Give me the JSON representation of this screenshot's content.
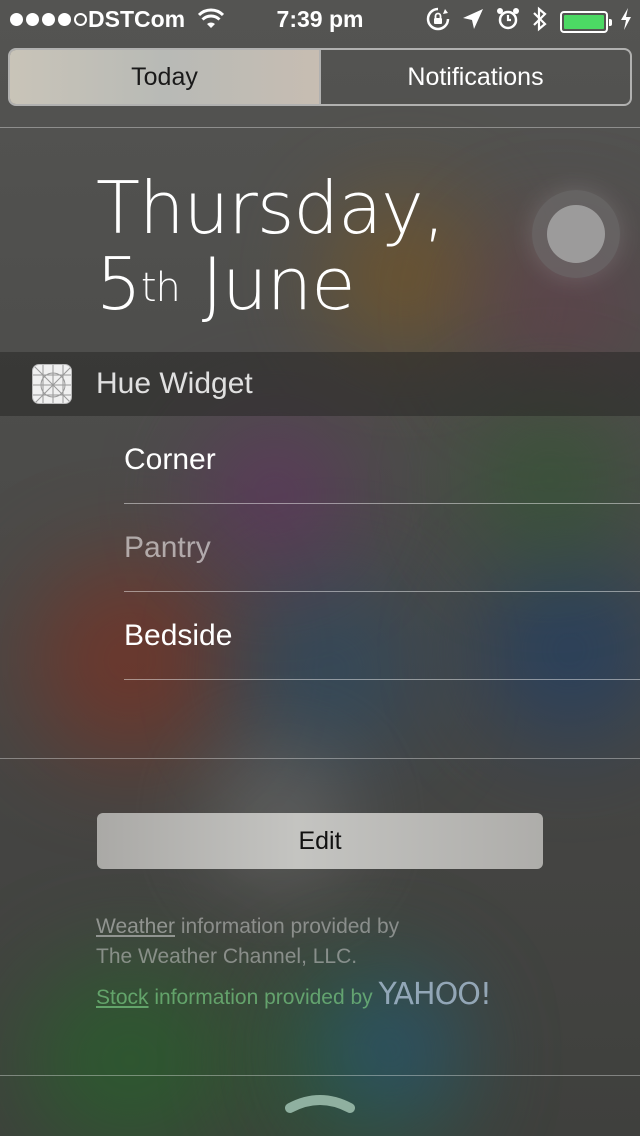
{
  "status_bar": {
    "carrier": "DSTCom",
    "time": "7:39 pm",
    "signal_bars_filled": 4,
    "signal_bars_total": 5,
    "battery_level": 1.0,
    "icons": [
      "wifi-icon",
      "rotation-lock-icon",
      "location-icon",
      "alarm-icon",
      "bluetooth-icon",
      "battery-icon",
      "charging-icon"
    ]
  },
  "tabs": [
    {
      "label": "Today",
      "active": true
    },
    {
      "label": "Notifications",
      "active": false
    }
  ],
  "date": {
    "line1": "Thursday,",
    "day": "5",
    "suffix": "th",
    "month": "June"
  },
  "widget": {
    "title": "Hue Widget",
    "items": [
      {
        "label": "Corner"
      },
      {
        "label": "Pantry"
      },
      {
        "label": "Bedside"
      }
    ]
  },
  "edit_label": "Edit",
  "credits": {
    "weather_link": "Weather",
    "weather_text": "information provided by",
    "weather_provider": "The Weather Channel, LLC.",
    "stock_link": "Stock",
    "stock_text": "information provided by",
    "stock_provider": "YAHOO!"
  },
  "colors": {
    "segment_active_bg": "#c4c0b6",
    "battery_fill": "#4cd964",
    "stock_text": "#78c882"
  }
}
